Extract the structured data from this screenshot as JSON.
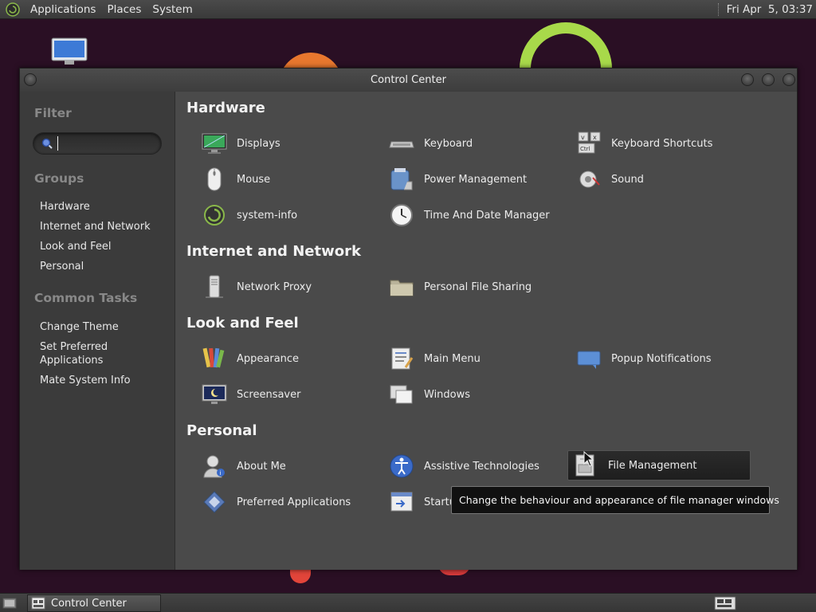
{
  "top_panel": {
    "menus": [
      "Applications",
      "Places",
      "System"
    ],
    "clock": "Fri Apr  5, 03:37"
  },
  "window": {
    "title": "Control Center"
  },
  "sidebar": {
    "filter_heading": "Filter",
    "search_value": "",
    "groups_heading": "Groups",
    "groups": [
      "Hardware",
      "Internet and Network",
      "Look and Feel",
      "Personal"
    ],
    "tasks_heading": "Common Tasks",
    "tasks": [
      "Change Theme",
      "Set Preferred Applications",
      "Mate System Info"
    ]
  },
  "sections": [
    {
      "title": "Hardware",
      "items": [
        {
          "label": "Displays",
          "icon": "display-icon"
        },
        {
          "label": "Keyboard",
          "icon": "keyboard-icon"
        },
        {
          "label": "Keyboard Shortcuts",
          "icon": "keyboard-shortcuts-icon"
        },
        {
          "label": "Mouse",
          "icon": "mouse-icon"
        },
        {
          "label": "Power Management",
          "icon": "power-icon"
        },
        {
          "label": "Sound",
          "icon": "sound-icon"
        },
        {
          "label": "system-info",
          "icon": "system-info-icon"
        },
        {
          "label": "Time And Date Manager",
          "icon": "clock-icon"
        }
      ]
    },
    {
      "title": "Internet and Network",
      "items": [
        {
          "label": "Network Proxy",
          "icon": "network-proxy-icon"
        },
        {
          "label": "Personal File Sharing",
          "icon": "folder-share-icon"
        }
      ]
    },
    {
      "title": "Look and Feel",
      "items": [
        {
          "label": "Appearance",
          "icon": "appearance-icon"
        },
        {
          "label": "Main Menu",
          "icon": "main-menu-icon"
        },
        {
          "label": "Popup Notifications",
          "icon": "notification-icon"
        },
        {
          "label": "Screensaver",
          "icon": "screensaver-icon"
        },
        {
          "label": "Windows",
          "icon": "windows-icon"
        }
      ]
    },
    {
      "title": "Personal",
      "items": [
        {
          "label": "About Me",
          "icon": "about-me-icon"
        },
        {
          "label": "Assistive Technologies",
          "icon": "accessibility-icon"
        },
        {
          "label": "File Management",
          "icon": "file-management-icon"
        },
        {
          "label": "Preferred Applications",
          "icon": "preferred-apps-icon"
        },
        {
          "label": "Startu",
          "icon": "startup-icon"
        }
      ]
    }
  ],
  "tooltip": "Change the behaviour and appearance of file manager windows",
  "bottom_panel": {
    "task_label": "Control Center"
  },
  "colors": {
    "content_bg": "#4a4a4a",
    "sidebar_bg": "#3b3b3b",
    "selected_bg": "#1e1e1e",
    "accent_green": "#a8d94a"
  }
}
